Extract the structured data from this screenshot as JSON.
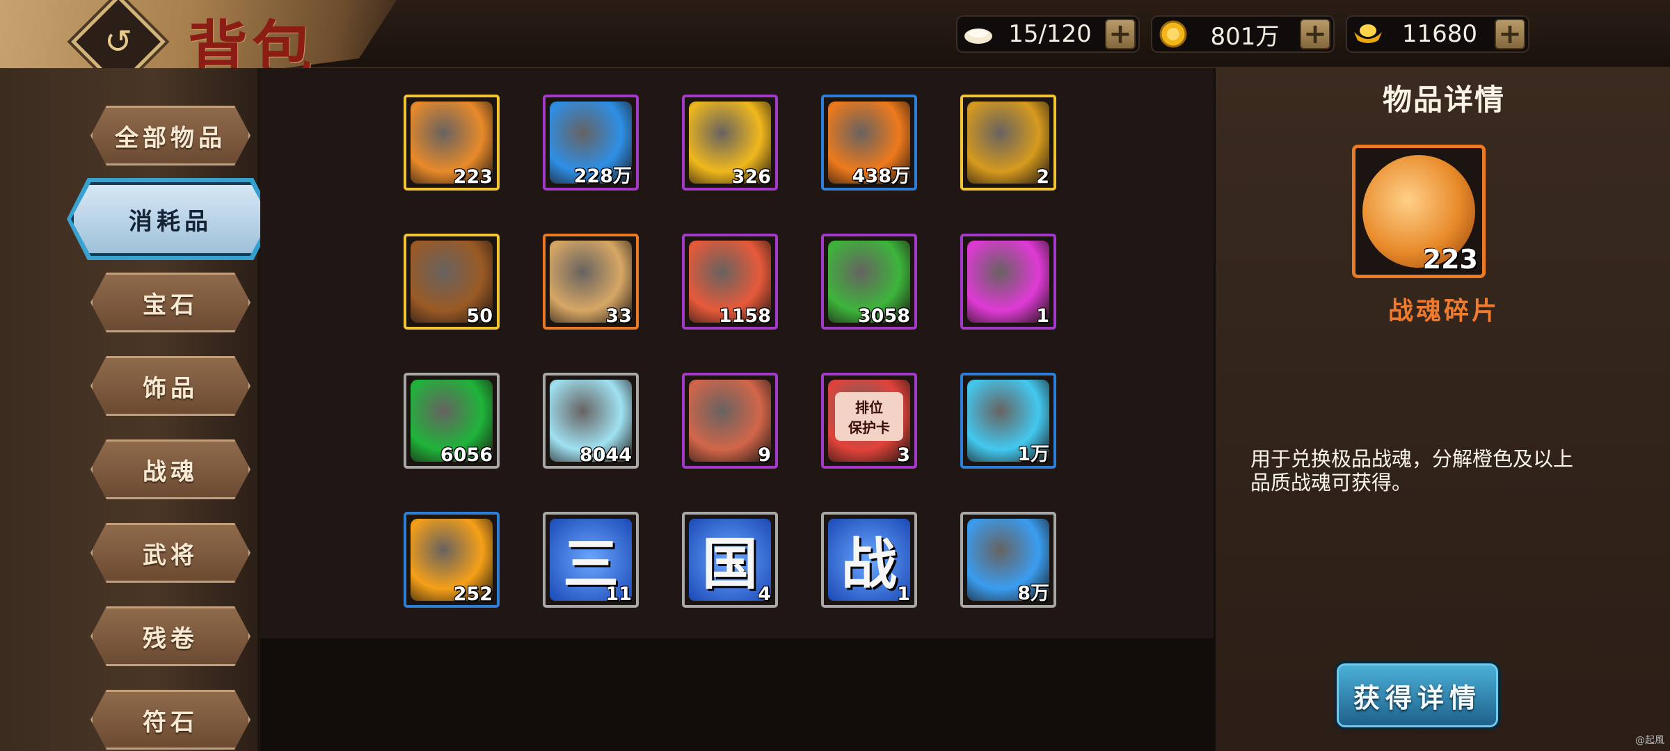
{
  "header": {
    "title": "背包",
    "back_icon": "back-swirl-icon",
    "resources": [
      {
        "name": "stamina",
        "icon": "bun-icon",
        "value": "15/120"
      },
      {
        "name": "coins",
        "icon": "coin-icon",
        "value": "801万"
      },
      {
        "name": "ingots",
        "icon": "gold-ingot-icon",
        "value": "11680"
      }
    ]
  },
  "sidebar": {
    "active_index": 1,
    "items": [
      {
        "label": "全部物品"
      },
      {
        "label": "消耗品"
      },
      {
        "label": "宝石"
      },
      {
        "label": "饰品"
      },
      {
        "label": "战魂"
      },
      {
        "label": "武将"
      },
      {
        "label": "残卷"
      },
      {
        "label": "符石"
      }
    ]
  },
  "grid": {
    "items": [
      {
        "icon": "cracked-orb-icon",
        "count": "223",
        "quality": "yellow",
        "color": "#e88a2a",
        "selected": true
      },
      {
        "icon": "blue-lightning-gem-icon",
        "count": "228万",
        "quality": "purple",
        "color": "#2e8fe6"
      },
      {
        "icon": "gold-wing-coin-icon",
        "count": "326",
        "quality": "purple",
        "color": "#f0b81d"
      },
      {
        "icon": "flame-scroll-icon",
        "count": "438万",
        "quality": "blue",
        "color": "#ee7a1c"
      },
      {
        "icon": "treasure-chest-icon",
        "count": "2",
        "quality": "yellow",
        "color": "#d69a1e"
      },
      {
        "icon": "amulet-icon",
        "count": "50",
        "quality": "yellow",
        "color": "#9b5a25"
      },
      {
        "icon": "parchment-icon",
        "count": "33",
        "quality": "orange",
        "color": "#d7a765"
      },
      {
        "icon": "shirt-puzzle-icon",
        "count": "1158",
        "quality": "purple",
        "color": "#e65a3a"
      },
      {
        "icon": "green-orb-icon",
        "count": "3058",
        "quality": "purple",
        "color": "#3db53b"
      },
      {
        "icon": "pink-vortex-icon",
        "count": "1",
        "quality": "purple",
        "color": "#e03ad6"
      },
      {
        "icon": "green-gem-icon",
        "count": "6056",
        "quality": "gray",
        "color": "#1fb43a"
      },
      {
        "icon": "crystal-shard-icon",
        "count": "8044",
        "quality": "gray",
        "color": "#9fe1f2"
      },
      {
        "icon": "torn-banner-icon",
        "count": "9",
        "quality": "purple",
        "color": "#d2664a"
      },
      {
        "icon": "rank-card-icon",
        "count": "3",
        "quality": "purple",
        "color": "#e2433b",
        "card_text": "排位\n保护卡"
      },
      {
        "icon": "ice-crystal-icon",
        "count": "1万",
        "quality": "blue",
        "color": "#43c8ef"
      },
      {
        "icon": "amber-gem-icon",
        "count": "252",
        "quality": "blue",
        "color": "#f5a018"
      },
      {
        "icon": "glyph-san-icon",
        "count": "11",
        "quality": "gray",
        "glyph": "三"
      },
      {
        "icon": "glyph-guo-icon",
        "count": "4",
        "quality": "gray",
        "glyph": "国"
      },
      {
        "icon": "glyph-zhan-icon",
        "count": "1",
        "quality": "gray",
        "glyph": "战"
      },
      {
        "icon": "blue-diamond-icon",
        "count": "8万",
        "quality": "gray",
        "color": "#3a9df0"
      }
    ]
  },
  "detail": {
    "title": "物品详情",
    "item_icon": "cracked-orb-icon",
    "count": "223",
    "name": "战魂碎片",
    "description": "用于兑换极品战魂，分解橙色及以上品质战魂可获得。",
    "button_label": "获得详情"
  },
  "watermark": "@起風"
}
